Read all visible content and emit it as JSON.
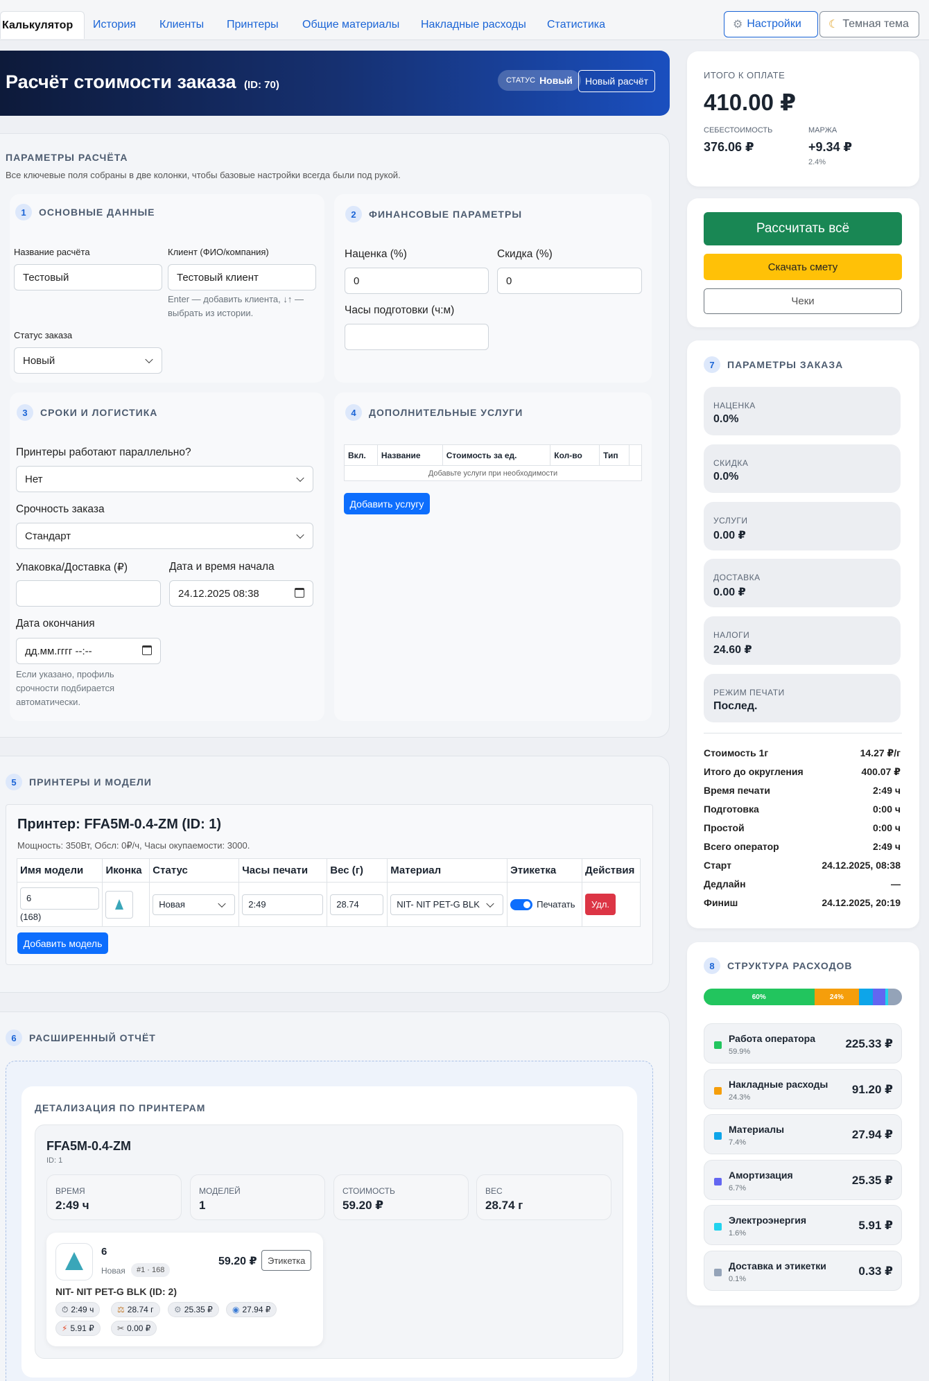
{
  "nav": {
    "tabs": [
      "Калькулятор",
      "История",
      "Клиенты",
      "Принтеры",
      "Общие материалы",
      "Накладные расходы",
      "Статистика"
    ],
    "settings": "Настройки",
    "dark_theme": "Темная тема"
  },
  "hero": {
    "title": "Расчёт стоимости заказа",
    "id": "(ID: 70)",
    "status_label": "СТАТУС",
    "status_value": "Новый",
    "new_calc": "Новый расчёт"
  },
  "params": {
    "title": "ПАРАМЕТРЫ РАСЧЁТА",
    "subtitle": "Все ключевые поля собраны в две колонки, чтобы базовые настройки всегда были под рукой."
  },
  "basic": {
    "num": "1",
    "title": "ОСНОВНЫЕ ДАННЫЕ",
    "name_label": "Название расчёта",
    "name_value": "Тестовый",
    "client_label": "Клиент (ФИО/компания)",
    "client_value": "Тестовый клиент",
    "client_help": "Enter — добавить клиента, ↓↑ — выбрать из истории.",
    "status_label": "Статус заказа",
    "status_value": "Новый"
  },
  "finance": {
    "num": "2",
    "title": "ФИНАНСОВЫЕ ПАРАМЕТРЫ",
    "markup_label": "Наценка (%)",
    "markup_value": "0",
    "discount_label": "Скидка (%)",
    "discount_value": "0",
    "prep_label": "Часы подготовки (ч:м)",
    "prep_value": ""
  },
  "terms": {
    "num": "3",
    "title": "СРОКИ И ЛОГИСТИКА",
    "parallel_label": "Принтеры работают параллельно?",
    "parallel_value": "Нет",
    "urgency_label": "Срочность заказа",
    "urgency_value": "Стандарт",
    "packaging_label": "Упаковка/Доставка (₽)",
    "packaging_value": "",
    "start_label": "Дата и время начала",
    "start_value": "24.12.2025 08:38",
    "end_label": "Дата окончания",
    "end_value": "дд.мм.гггг --:--",
    "end_help": "Если указано, профиль срочности подбирается автоматически."
  },
  "services": {
    "num": "4",
    "title": "ДОПОЛНИТЕЛЬНЫЕ УСЛУГИ",
    "columns": [
      "Вкл.",
      "Название",
      "Стоимость за ед.",
      "Кол-во",
      "Тип",
      ""
    ],
    "empty": "Добавьте услуги при необходимости",
    "add": "Добавить услугу"
  },
  "printers": {
    "num": "5",
    "title": "ПРИНТЕРЫ И МОДЕЛИ",
    "printer_title": "Принтер: FFA5M-0.4-ZM (ID: 1)",
    "printer_info": "Мощность: 350Вт, Обсл: 0₽/ч, Часы окупаемости: 3000.",
    "columns": [
      "Имя модели",
      "Иконка",
      "Статус",
      "Часы печати",
      "Вес (г)",
      "Материал",
      "Этикетка",
      "Действия"
    ],
    "row": {
      "model": "6",
      "model_sub": "(168)",
      "status": "Новая",
      "hours": "2:49",
      "weight": "28.74",
      "material": "NIT- NIT PET-G BLK",
      "label": "Печатать",
      "delete": "Удл."
    },
    "add_model": "Добавить модель"
  },
  "report": {
    "num": "6",
    "title": "РАСШИРЕННЫЙ ОТЧЁТ",
    "detail_title": "ДЕТАЛИЗАЦИЯ ПО ПРИНТЕРАМ",
    "printer_name": "FFA5M-0.4-ZM",
    "printer_id": "ID: 1",
    "stats": [
      {
        "k": "ВРЕМЯ",
        "v": "2:49 ч"
      },
      {
        "k": "МОДЕЛЕЙ",
        "v": "1"
      },
      {
        "k": "СТОИМОСТЬ",
        "v": "59.20 ₽"
      },
      {
        "k": "ВЕС",
        "v": "28.74 г"
      }
    ],
    "model_name": "6",
    "model_status": "Новая",
    "model_tag": "#1 · 168",
    "model_price": "59.20 ₽",
    "label_btn": "Этикетка",
    "material": "NIT- NIT PET-G BLK (ID: 2)",
    "chips": [
      "2:49 ч",
      "28.74 г",
      "25.35 ₽",
      "27.94 ₽",
      "5.91 ₽",
      "0.00 ₽"
    ]
  },
  "total": {
    "label": "ИТОГО К ОПЛАТЕ",
    "value": "410.00 ₽",
    "cost_label": "СЕБЕСТОИМОСТЬ",
    "cost_value": "376.06 ₽",
    "margin_label": "МАРЖА",
    "margin_value": "+9.34 ₽",
    "margin_pct": "2.4%"
  },
  "actions": {
    "calc": "Рассчитать всё",
    "estimate": "Скачать смету",
    "receipts": "Чеки"
  },
  "order": {
    "num": "7",
    "title": "ПАРАМЕТРЫ ЗАКАЗА",
    "boxes": [
      {
        "k": "НАЦЕНКА",
        "v": "0.0%"
      },
      {
        "k": "СКИДКА",
        "v": "0.0%"
      },
      {
        "k": "УСЛУГИ",
        "v": "0.00 ₽"
      },
      {
        "k": "ДОСТАВКА",
        "v": "0.00 ₽"
      },
      {
        "k": "НАЛОГИ",
        "v": "24.60 ₽"
      },
      {
        "k": "РЕЖИМ ПЕЧАТИ",
        "v": "Послед."
      }
    ],
    "rows": [
      {
        "k": "Стоимость 1г",
        "v": "14.27 ₽/г"
      },
      {
        "k": "Итого до округления",
        "v": "400.07 ₽"
      },
      {
        "k": "Время печати",
        "v": "2:49 ч"
      },
      {
        "k": "Подготовка",
        "v": "0:00 ч"
      },
      {
        "k": "Простой",
        "v": "0:00 ч"
      },
      {
        "k": "Всего оператор",
        "v": "2:49 ч"
      },
      {
        "k": "Старт",
        "v": "24.12.2025, 08:38"
      },
      {
        "k": "Дедлайн",
        "v": "—"
      },
      {
        "k": "Финиш",
        "v": "24.12.2025, 20:19"
      }
    ]
  },
  "structure": {
    "num": "8",
    "title": "СТРУКТУРА РАСХОДОВ",
    "bar": [
      {
        "pct": 59.9,
        "text": "60%",
        "color": "#22c55e"
      },
      {
        "pct": 24.3,
        "text": "24%",
        "color": "#f59e0b"
      },
      {
        "pct": 7.4,
        "text": "",
        "color": "#0ea5e9"
      },
      {
        "pct": 6.7,
        "text": "",
        "color": "#6366f1"
      },
      {
        "pct": 1.6,
        "text": "",
        "color": "#22d3ee"
      },
      {
        "pct": 0.1,
        "text": "",
        "color": "#94a3b8"
      }
    ],
    "items": [
      {
        "n": "Работа оператора",
        "p": "59.9%",
        "v": "225.33 ₽",
        "c": "#22c55e"
      },
      {
        "n": "Накладные расходы",
        "p": "24.3%",
        "v": "91.20 ₽",
        "c": "#f59e0b"
      },
      {
        "n": "Материалы",
        "p": "7.4%",
        "v": "27.94 ₽",
        "c": "#0ea5e9"
      },
      {
        "n": "Амортизация",
        "p": "6.7%",
        "v": "25.35 ₽",
        "c": "#6366f1"
      },
      {
        "n": "Электроэнергия",
        "p": "1.6%",
        "v": "5.91 ₽",
        "c": "#22d3ee"
      },
      {
        "n": "Доставка и этикетки",
        "p": "0.1%",
        "v": "0.33 ₽",
        "c": "#94a3b8"
      }
    ]
  }
}
